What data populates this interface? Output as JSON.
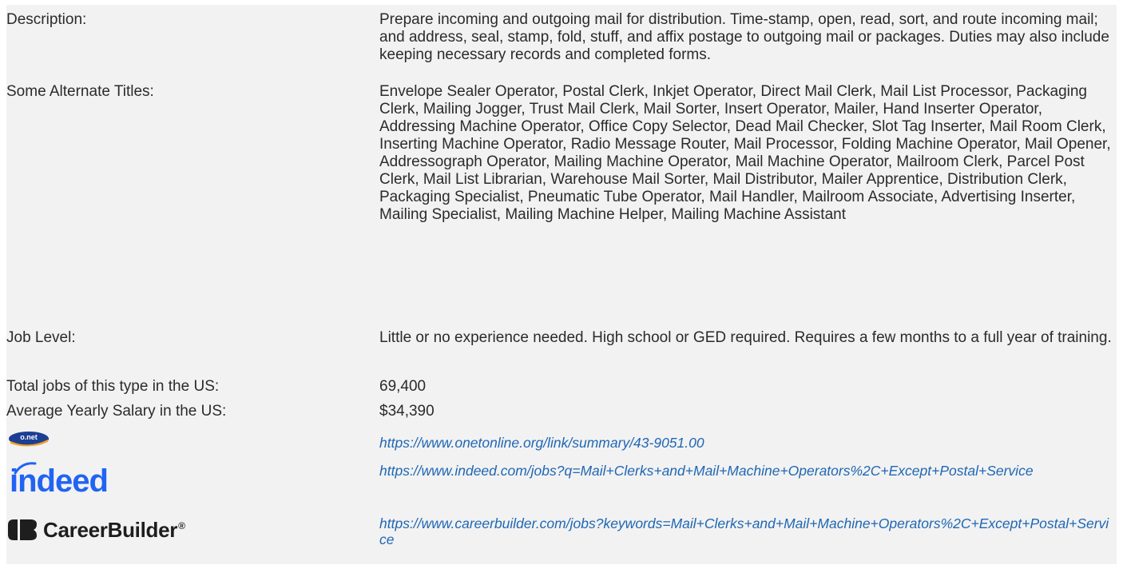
{
  "rows": {
    "description": {
      "label": "Description:",
      "value": "Prepare incoming and outgoing mail for distribution. Time-stamp, open, read, sort, and route incoming mail; and address, seal, stamp, fold, stuff, and affix postage to outgoing mail or packages. Duties may also include keeping necessary records and completed forms."
    },
    "alternate_titles": {
      "label": "Some Alternate Titles:",
      "value": "Envelope Sealer Operator, Postal Clerk, Inkjet Operator, Direct Mail Clerk, Mail List Processor, Packaging Clerk, Mailing Jogger, Trust Mail Clerk, Mail Sorter, Insert Operator, Mailer, Hand Inserter Operator, Addressing Machine Operator, Office Copy Selector, Dead Mail Checker, Slot Tag Inserter, Mail Room Clerk, Inserting Machine Operator, Radio Message Router, Mail Processor, Folding Machine Operator, Mail Opener, Addressograph Operator, Mailing Machine Operator, Mail Machine Operator, Mailroom Clerk, Parcel Post Clerk, Mail List Librarian, Warehouse Mail Sorter, Mail Distributor, Mailer Apprentice, Distribution Clerk, Packaging Specialist, Pneumatic Tube Operator, Mail Handler, Mailroom Associate, Advertising Inserter, Mailing Specialist, Mailing Machine Helper, Mailing Machine Assistant"
    },
    "job_level": {
      "label": "Job Level:",
      "value": "Little or no experience needed. High school or GED required. Requires a few months to a full year of training."
    },
    "total_jobs": {
      "label": "Total jobs of this type in the US:",
      "value": "69,400"
    },
    "salary": {
      "label": "Average Yearly Salary in the US:",
      "value": "$34,390"
    }
  },
  "links": {
    "onet": {
      "logo_text": "o.net",
      "logo_icon": "onet-logo",
      "url": "https://www.onetonline.org/link/summary/43-9051.00"
    },
    "indeed": {
      "logo_text": "indeed",
      "logo_icon": "indeed-logo",
      "url": "https://www.indeed.com/jobs?q=Mail+Clerks+and+Mail+Machine+Operators%2C+Except+Postal+Service"
    },
    "careerbuilder": {
      "logo_text": "CareerBuilder",
      "logo_mark": "®",
      "logo_icon": "careerbuilder-logo",
      "url": "https://www.careerbuilder.com/jobs?keywords=Mail+Clerks+and+Mail+Machine+Operators%2C+Except+Postal+Service"
    }
  },
  "colors": {
    "background": "#f2f2f2",
    "text": "#2b2b2b",
    "link": "#1f67b4",
    "indeed_blue": "#2164f3",
    "careerbuilder_dark": "#1e1e1e",
    "onet_orange": "#f5a623",
    "onet_navy": "#1c3f94"
  }
}
